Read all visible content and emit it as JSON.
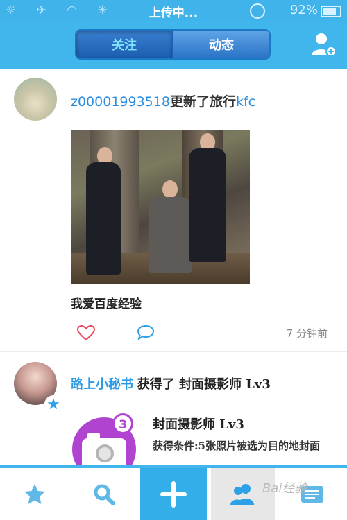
{
  "status_bar": {
    "title": "上传中...",
    "battery": "92%"
  },
  "header": {
    "tabs": [
      {
        "label": "关注"
      },
      {
        "label": "动态"
      }
    ]
  },
  "feed": {
    "post1": {
      "username": "z00001993518",
      "action": "更新了旅行",
      "target": "kfc",
      "caption": "我爱百度经验",
      "time": "7 分钟前"
    },
    "post2": {
      "username": "路上小秘书",
      "action": "获得了 封面摄影师 Lv3",
      "achievement_title": "封面摄影师 Lv3",
      "achievement_desc": "获得条件:5张照片被选为目的地封面",
      "badge_count": "3"
    }
  },
  "tabbar": {
    "items": [
      {
        "name": "favorites",
        "icon": "star-icon"
      },
      {
        "name": "search",
        "icon": "search-icon"
      },
      {
        "name": "add",
        "icon": "plus-icon"
      },
      {
        "name": "friends",
        "icon": "people-icon"
      },
      {
        "name": "messages",
        "icon": "list-icon"
      }
    ]
  },
  "watermark": "Bai经验",
  "colors": {
    "accent": "#41b6ec",
    "link": "#2a8de0",
    "badge": "#b043cf"
  }
}
